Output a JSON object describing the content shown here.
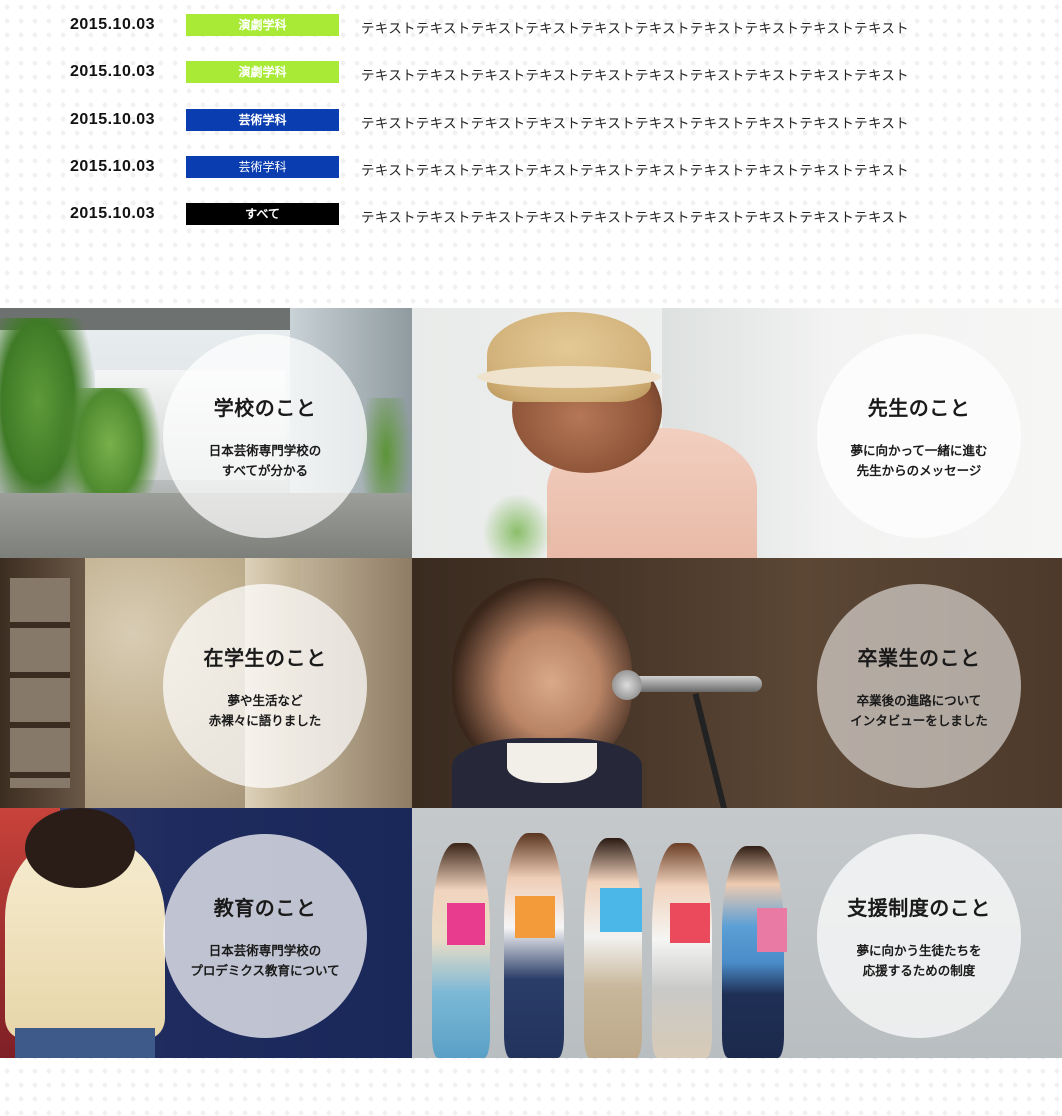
{
  "news": [
    {
      "date": "2015.10.03",
      "category": "演劇学科",
      "category_color": "#a8ea36",
      "category_bold": true,
      "text": "テキストテキストテキストテキストテキストテキストテキストテキストテキストテキスト"
    },
    {
      "date": "2015.10.03",
      "category": "演劇学科",
      "category_color": "#a8ea36",
      "category_bold": true,
      "text": "テキストテキストテキストテキストテキストテキストテキストテキストテキストテキスト"
    },
    {
      "date": "2015.10.03",
      "category": "芸術学科",
      "category_color": "#0a3db0",
      "category_bold": true,
      "text": "テキストテキストテキストテキストテキストテキストテキストテキストテキストテキスト"
    },
    {
      "date": "2015.10.03",
      "category": "芸術学科",
      "category_color": "#0a3db0",
      "category_bold": false,
      "text": "テキストテキストテキストテキストテキストテキストテキストテキストテキストテキスト"
    },
    {
      "date": "2015.10.03",
      "category": "すべて",
      "category_color": "#000000",
      "category_bold": true,
      "text": "テキストテキストテキストテキストテキストテキストテキストテキストテキストテキスト"
    }
  ],
  "panels": {
    "school": {
      "title": "学校のこと",
      "desc1": "日本芸術専門学校の",
      "desc2": "すべてが分かる"
    },
    "teacher": {
      "title": "先生のこと",
      "desc1": "夢に向かって一緒に進む",
      "desc2": "先生からのメッセージ"
    },
    "student": {
      "title": "在学生のこと",
      "desc1": "夢や生活など",
      "desc2": "赤裸々に語りました"
    },
    "graduate": {
      "title": "卒業生のこと",
      "desc1": "卒業後の進路について",
      "desc2": "インタビューをしました"
    },
    "education": {
      "title": "教育のこと",
      "desc1": "日本芸術専門学校の",
      "desc2": "プロデミクス教育について"
    },
    "support": {
      "title": "支援制度のこと",
      "desc1": "夢に向かう生徒たちを",
      "desc2": "応援するための制度"
    }
  }
}
